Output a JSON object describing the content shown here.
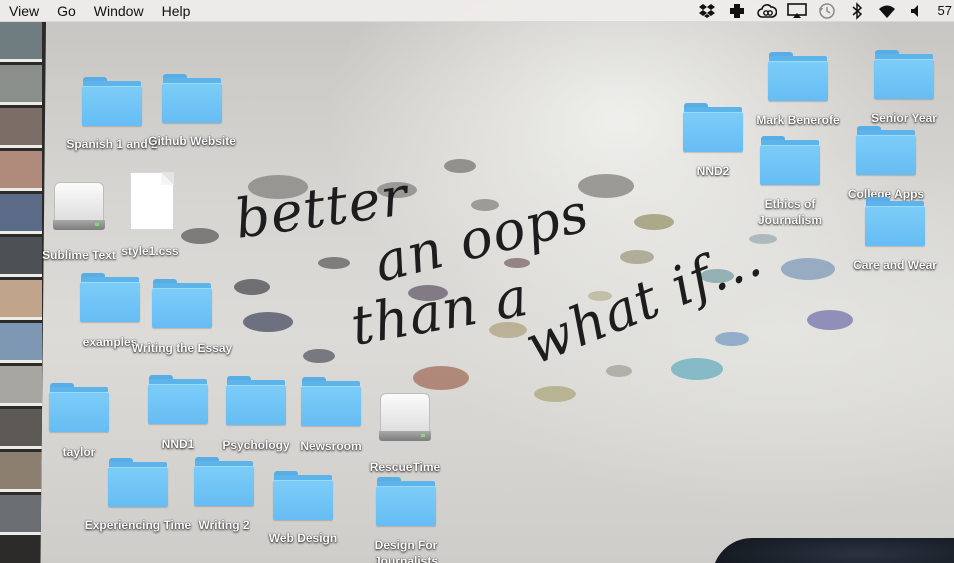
{
  "menubar": {
    "items": [
      "View",
      "Go",
      "Window",
      "Help"
    ],
    "status_icons": [
      "dropbox-icon",
      "medical-cross-icon",
      "creative-cloud-icon",
      "airplay-icon",
      "time-machine-icon",
      "bluetooth-icon",
      "wifi-icon",
      "volume-icon"
    ],
    "clock": "57"
  },
  "wallpaper": {
    "quote_lines": [
      "better",
      "an oops",
      "than a",
      "what if..."
    ]
  },
  "desktop": {
    "icons": [
      {
        "label": "Spanish 1 and 2",
        "kind": "folder"
      },
      {
        "label": "Github Website",
        "kind": "folder"
      },
      {
        "label": "Sublime Text",
        "kind": "drive"
      },
      {
        "label": "style1.css",
        "kind": "document"
      },
      {
        "label": "examples",
        "kind": "folder"
      },
      {
        "label": "Writing the Essay",
        "kind": "folder"
      },
      {
        "label": "taylor",
        "kind": "folder"
      },
      {
        "label": "NND1",
        "kind": "folder"
      },
      {
        "label": "Psychology",
        "kind": "folder"
      },
      {
        "label": "Newsroom",
        "kind": "folder"
      },
      {
        "label": "RescueTime",
        "kind": "drive"
      },
      {
        "label": "Experiencing Time",
        "kind": "folder"
      },
      {
        "label": "Writing 2",
        "kind": "folder"
      },
      {
        "label": "Web Design",
        "kind": "folder"
      },
      {
        "label": "Design For Journalists",
        "kind": "folder"
      },
      {
        "label": "NND2",
        "kind": "folder"
      },
      {
        "label": "Mark Benerofe",
        "kind": "folder"
      },
      {
        "label": "Senior Year",
        "kind": "folder"
      },
      {
        "label": "Ethics of Journalism",
        "kind": "folder"
      },
      {
        "label": "College Apps",
        "kind": "folder"
      },
      {
        "label": "Care and Wear",
        "kind": "folder"
      }
    ]
  }
}
